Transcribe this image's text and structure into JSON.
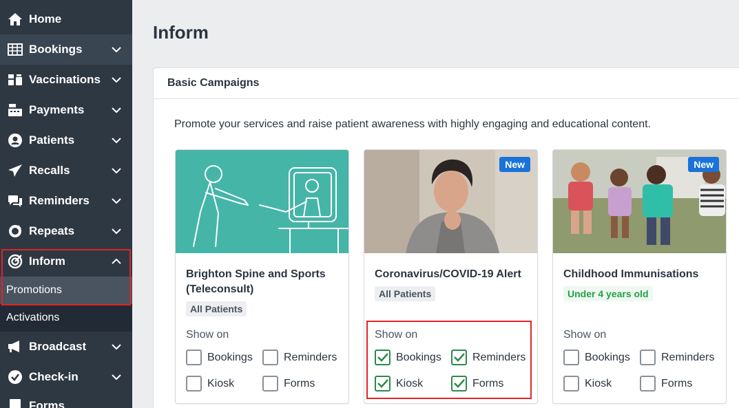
{
  "sidebar": {
    "items": [
      {
        "label": "Home",
        "icon": "home-icon"
      },
      {
        "label": "Bookings",
        "icon": "calendar-grid-icon"
      },
      {
        "label": "Vaccinations",
        "icon": "vials-icon"
      },
      {
        "label": "Payments",
        "icon": "cash-register-icon"
      },
      {
        "label": "Patients",
        "icon": "user-circle-icon"
      },
      {
        "label": "Recalls",
        "icon": "paper-plane-icon"
      },
      {
        "label": "Reminders",
        "icon": "comments-icon"
      },
      {
        "label": "Repeats",
        "icon": "refresh-icon"
      },
      {
        "label": "Inform",
        "icon": "target-icon"
      },
      {
        "label": "Broadcast",
        "icon": "megaphone-icon"
      },
      {
        "label": "Check-in",
        "icon": "check-circle-icon"
      },
      {
        "label": "Forms",
        "icon": "form-icon"
      }
    ],
    "subitems": {
      "promotions": "Promotions",
      "activations": "Activations"
    }
  },
  "page": {
    "title": "Inform"
  },
  "panel": {
    "title": "Basic Campaigns",
    "description": "Promote your services and raise patient awareness with highly engaging and educational content."
  },
  "cards": [
    {
      "title": "Brighton Spine and Sports (Teleconsult)",
      "tag": "All Patients",
      "show_on_label": "Show on",
      "options": [
        {
          "label": "Bookings",
          "checked": false
        },
        {
          "label": "Reminders",
          "checked": false
        },
        {
          "label": "Kiosk",
          "checked": false
        },
        {
          "label": "Forms",
          "checked": false
        }
      ]
    },
    {
      "title": "Coronavirus/COVID-19 Alert",
      "badge": "New",
      "tag": "All Patients",
      "show_on_label": "Show on",
      "options": [
        {
          "label": "Bookings",
          "checked": true
        },
        {
          "label": "Reminders",
          "checked": true
        },
        {
          "label": "Kiosk",
          "checked": true
        },
        {
          "label": "Forms",
          "checked": true
        }
      ]
    },
    {
      "title": "Childhood Immunisations",
      "badge": "New",
      "tag": "Under 4 years old",
      "show_on_label": "Show on",
      "options": [
        {
          "label": "Bookings",
          "checked": false
        },
        {
          "label": "Reminders",
          "checked": false
        },
        {
          "label": "Kiosk",
          "checked": false
        },
        {
          "label": "Forms",
          "checked": false
        }
      ]
    }
  ],
  "colors": {
    "sidebar_bg": "#2e3843",
    "highlight": "#e02424",
    "badge": "#1a73d9",
    "check": "#2a8a4a",
    "teal": "#45b5a8"
  }
}
